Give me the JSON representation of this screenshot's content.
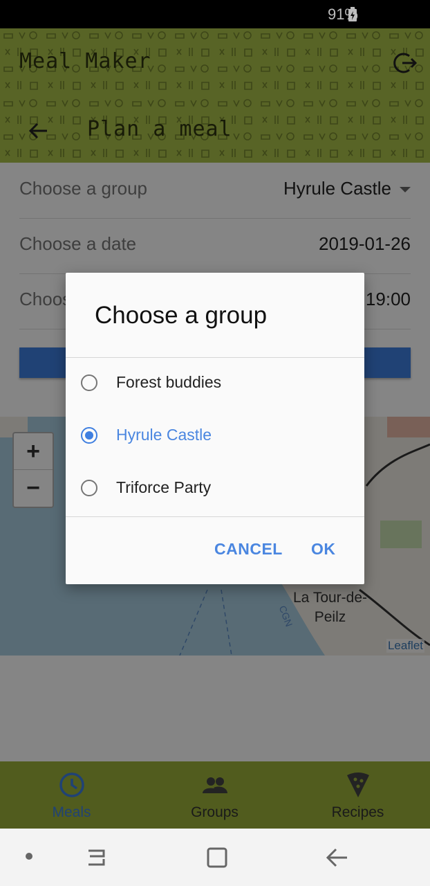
{
  "status": {
    "battery": "91%"
  },
  "app": {
    "title": "Meal Maker",
    "subtitle": "Plan a meal"
  },
  "form": {
    "group_label": "Choose a group",
    "group_value": "Hyrule Castle",
    "date_label": "Choose a date",
    "date_value": "2019-01-26",
    "time_label": "Choose a time",
    "time_value": "19:00"
  },
  "map": {
    "zoom_in": "+",
    "zoom_out": "−",
    "place_line1": "La Tour-de-",
    "place_line2": "Peilz",
    "attribution": "Leaflet",
    "small_label": "CGN"
  },
  "dialog": {
    "title": "Choose a group",
    "options": [
      {
        "label": "Forest buddies",
        "selected": false
      },
      {
        "label": "Hyrule Castle",
        "selected": true
      },
      {
        "label": "Triforce Party",
        "selected": false
      }
    ],
    "cancel": "CANCEL",
    "ok": "OK"
  },
  "bottom_nav": {
    "items": [
      {
        "label": "Meals",
        "icon": "clock-icon",
        "active": true
      },
      {
        "label": "Groups",
        "icon": "people-icon",
        "active": false
      },
      {
        "label": "Recipes",
        "icon": "pizza-icon",
        "active": false
      }
    ]
  },
  "colors": {
    "appbar": "#aac04a",
    "bottom_nav": "#9bb03a",
    "accent": "#3f7fe0"
  }
}
